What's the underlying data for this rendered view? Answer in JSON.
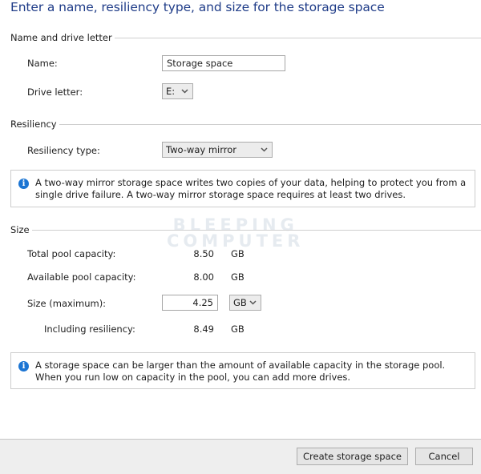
{
  "header": {
    "title": "Enter a name, resiliency type, and size for the storage space"
  },
  "name_section": {
    "heading": "Name and drive letter",
    "name_label": "Name:",
    "name_value": "Storage space",
    "drive_letter_label": "Drive letter:",
    "drive_letter_value": "E:"
  },
  "resiliency_section": {
    "heading": "Resiliency",
    "type_label": "Resiliency type:",
    "type_value": "Two-way mirror",
    "info_icon": "info-icon",
    "info_text": "A two-way mirror storage space writes two copies of your data, helping to protect you from a single drive failure. A two-way mirror storage space requires at least two drives."
  },
  "size_section": {
    "heading": "Size",
    "total_label": "Total pool capacity:",
    "total_value": "8.50",
    "total_unit": "GB",
    "available_label": "Available pool capacity:",
    "available_value": "8.00",
    "available_unit": "GB",
    "size_label": "Size (maximum):",
    "size_value": "4.25",
    "size_unit": "GB",
    "including_label": "Including resiliency:",
    "including_value": "8.49",
    "including_unit": "GB",
    "info_icon": "info-icon",
    "info_text": "A storage space can be larger than the amount of available capacity in the storage pool. When you run low on capacity in the pool, you can add more drives."
  },
  "watermark": {
    "line1": "BLEEPING",
    "line2": "COMPUTER"
  },
  "footer": {
    "create_label": "Create storage space",
    "cancel_label": "Cancel"
  }
}
